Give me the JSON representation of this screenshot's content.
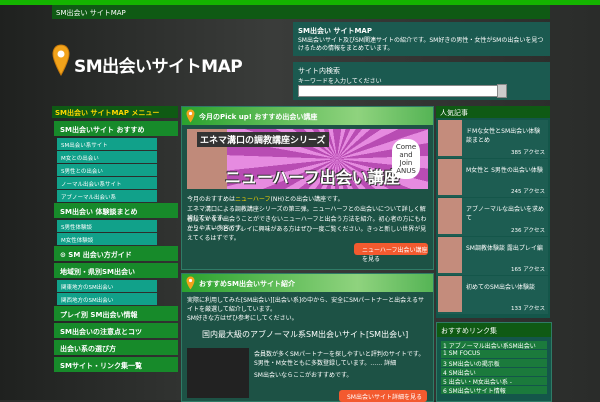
{
  "topnav": {
    "text": "SM出会い サイトMAP"
  },
  "logo": {
    "text": "SM出会いサイトMAP"
  },
  "siteinfo": {
    "heading": "SM出会い サイトMAP",
    "description": "SM出会いサイト及びSM関連サイトの紹介です。SM好きの男性・女性がSMの出会いを見つけるための情報をまとめています。"
  },
  "search": {
    "heading": "サイト内検索",
    "description": "キーワードを入力してください"
  },
  "leftmenu": {
    "header": "SM出会い サイトMAP メニュー",
    "items": [
      {
        "kind": "main",
        "label": "SM出会いサイト おすすめ"
      },
      {
        "kind": "sub",
        "label": "SM出会い系サイト"
      },
      {
        "kind": "sub",
        "label": "M女との出会い"
      },
      {
        "kind": "sub",
        "label": "S男性との出会い"
      },
      {
        "kind": "sub",
        "label": "ノーマル出会い系サイト"
      },
      {
        "kind": "sub",
        "label": "アブノーマル出会い系"
      },
      {
        "kind": "main",
        "label": "SM出会い 体験談まとめ"
      },
      {
        "kind": "sub",
        "label": "S男性体験談"
      },
      {
        "kind": "sub",
        "label": "M女性体験談"
      },
      {
        "kind": "main",
        "label": "⊙ SM 出会い方ガイド"
      },
      {
        "kind": "main",
        "label": "地域別・県別SM出会い"
      },
      {
        "kind": "sub",
        "label": "関東地方のSM出会い"
      },
      {
        "kind": "sub",
        "label": "関西地方のSM出会い"
      },
      {
        "kind": "main",
        "label": "プレイ別 SM出会い情報"
      },
      {
        "kind": "main",
        "label": "SM出会いの注意点とコツ"
      },
      {
        "kind": "main",
        "label": "出会い系の選び方"
      },
      {
        "kind": "main",
        "label": "SMサイト・リンク集一覧"
      }
    ]
  },
  "pickup": {
    "heading": "今月のPick up! おすすめ出会い講座",
    "banner_top": "エネマ溝口の調教講座シリーズ",
    "banner_main": "ニューハーフ出会い講座",
    "banner_badge": "Come and Join ANUS",
    "line1_pre": "今月のおすすめは",
    "line1_hl": "ニューハーフ",
    "line1_post": "(NH)との出会い講座です。",
    "line2": "エネマ溝口による調教講座シリーズの第三弾。ニューハーフとの出会いについて詳しく解説しています。",
    "line3": "普段なかなか出会うことができないニューハーフと出会う方法を紹介。初心者の方にもわかりやすい内容です。",
    "line4": "ニューハーフとのプレイに興味がある方はぜひ一度ご覧ください。きっと新しい世界が見えてくるはずです。",
    "button": "ニューハーフ出会い講座を見る"
  },
  "review": {
    "heading": "おすすめSM出会いサイト紹介",
    "text1": "実際に利用してみた[SM出会い][出会い系]の中から、安全にSMパートナーと出会えるサイトを厳選して紹介しています。",
    "text2": "SM好きな方はぜひ参考にしてください。",
    "site_title": "国内最大級のアブノーマル系SM出会いサイト[SM出会い]",
    "site_desc": "会員数が多くSMパートナーを探しやすいと評判のサイトです。S男性・M女性ともに多数登録しています。…… 詳細",
    "site_desc2": "SM出会いならここがおすすめです。",
    "button": "SM出会いサイト詳細を見る"
  },
  "ranking": {
    "heading": "人気記事",
    "items": [
      {
        "title": "ドMな女性とSM出会い体験談まとめ",
        "count": "385 アクセス"
      },
      {
        "title": "M女性と S男性の出会い体験",
        "count": "245 アクセス"
      },
      {
        "title": "アブノーマルな出会いを求めて",
        "count": "236 アクセス"
      },
      {
        "title": "SM調教体験談 露出プレイ編",
        "count": "165 アクセス"
      },
      {
        "title": "初めてのSM出会い体験談",
        "count": "133 アクセス"
      }
    ]
  },
  "links": {
    "heading": "おすすめリンク集",
    "items": [
      "1 アブノーマル出会い系SM出会いLOVERS",
      "1 SM FOCUS",
      "3 SM出会いの掲示板",
      "4 SM出会い",
      "5 出会い・M女出会い系 -",
      "6 SM出会いサイト情報"
    ]
  },
  "colors": {
    "accent": "#14b400",
    "panel": "#1d5245",
    "button": "#f35a2f",
    "highlight": "#ffd800"
  }
}
